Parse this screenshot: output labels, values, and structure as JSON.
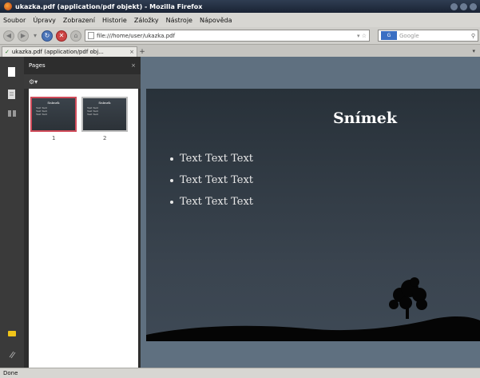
{
  "window": {
    "title": "ukazka.pdf (application/pdf objekt) - Mozilla Firefox"
  },
  "menu": [
    "Soubor",
    "Úpravy",
    "Zobrazení",
    "Historie",
    "Záložky",
    "Nástroje",
    "Nápověda"
  ],
  "nav": {
    "url": "file:///home/user/ukazka.pdf",
    "search_placeholder": "Google",
    "search_engine": "G"
  },
  "tab": {
    "label": "ukazka.pdf (application/pdf obj..."
  },
  "sidebar": {
    "title": "Pages",
    "thumbnails": [
      {
        "number": "1",
        "title": "Snímek",
        "lines": [
          "Text Text",
          "Text Text",
          "Text Text"
        ],
        "selected": true
      },
      {
        "number": "2",
        "title": "Snímek",
        "lines": [
          "Text Text",
          "Text Text",
          "Text Text"
        ],
        "selected": false
      }
    ]
  },
  "slide": {
    "title": "Snímek",
    "bullets": [
      "Text Text Text",
      "Text Text Text",
      "Text Text Text"
    ]
  },
  "status": {
    "text": "Done"
  },
  "colors": {
    "accent_selected": "#d04b5a",
    "doc_background": "#5f7080",
    "slide_top": "#283139",
    "slide_bottom": "#3e4955"
  }
}
